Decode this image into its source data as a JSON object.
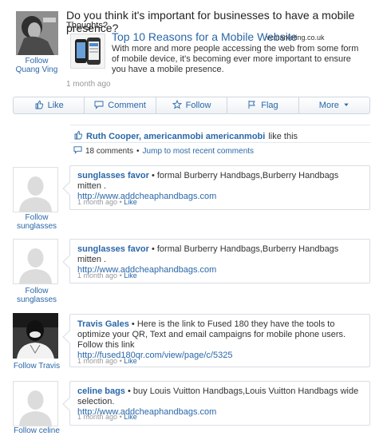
{
  "post": {
    "author_follow": "Follow Quang Ving",
    "question": "Do you think it's important for businesses to have a mobile presence?",
    "thoughts": "Thoughts?",
    "link": {
      "title": "Top 10 Reasons for a Mobile Website",
      "source": "vcmarketing.co.uk",
      "description": "With more and more people accessing the web from some form of mobile device, it's becoming ever more important to ensure you have a mobile presence."
    },
    "time": "1 month ago"
  },
  "actions": {
    "like": "Like",
    "comment": "Comment",
    "follow": "Follow",
    "flag": "Flag",
    "more": "More"
  },
  "likes": {
    "names": "Ruth Cooper, americanmobi americanmobi",
    "suffix": "like this"
  },
  "comments_summary": {
    "count": "18 comments",
    "jump": "Jump to most recent comments"
  },
  "comments": [
    {
      "author": "sunglasses favor",
      "text": "formal Burberry Handbags,Burberry Handbags mitten .",
      "url": "http://www.addcheaphandbags.com",
      "time": "1 month ago",
      "like": "Like",
      "follow": "Follow sunglasses"
    },
    {
      "author": "sunglasses favor",
      "text": "formal Burberry Handbags,Burberry Handbags mitten .",
      "url": "http://www.addcheaphandbags.com",
      "time": "1 month ago",
      "like": "Like",
      "follow": "Follow sunglasses"
    },
    {
      "author": "Travis Gales",
      "text": "Here is the link to Fused 180 they have the tools to optimize your QR, Text and email campaigns for mobile phone users. Follow this link",
      "url": "http://fused180qr.com/view/page/c/5325",
      "time": "1 month ago",
      "like": "Like",
      "follow": "Follow Travis"
    },
    {
      "author": "celine bags",
      "text": "buy Louis Vuitton Handbags,Louis Vuitton Handbags wide selection.",
      "url": "http://www.addcheaphandbags.com",
      "time": "1 month ago",
      "like": "Like",
      "follow": "Follow celine"
    }
  ],
  "separator": "•",
  "colors": {
    "link": "#2a67a8",
    "muted": "#999999",
    "border": "#d8dde3"
  }
}
